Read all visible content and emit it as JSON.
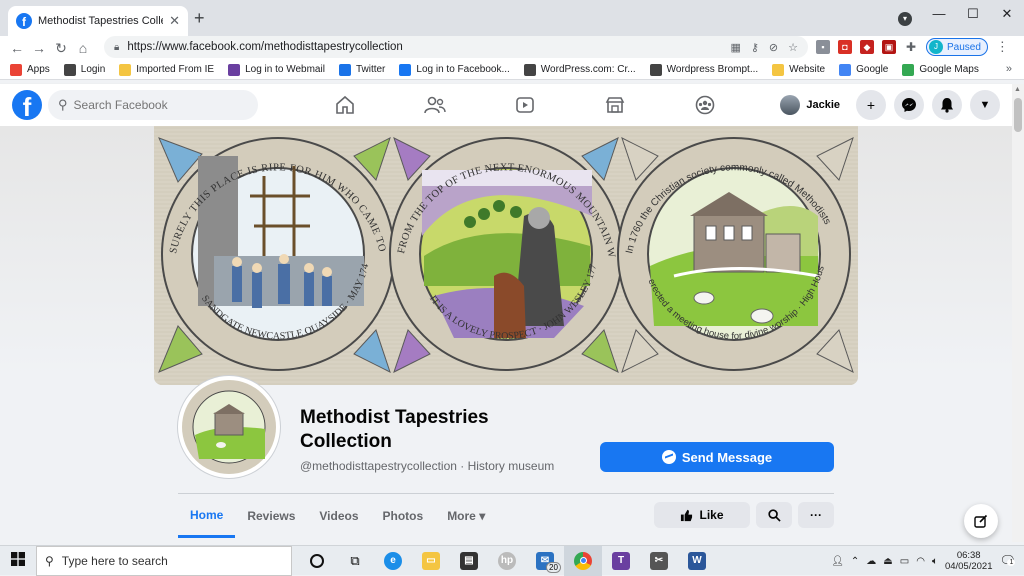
{
  "browser": {
    "tab_title": "Methodist Tapestries Collection |",
    "url": "https://www.facebook.com/methodisttapestrycollection",
    "profile_status": "Paused",
    "profile_initial": "J",
    "bookmarks": [
      {
        "label": "Apps",
        "color": "#ea4335"
      },
      {
        "label": "Login",
        "color": "#444444"
      },
      {
        "label": "Imported From IE",
        "color": "#f4c542"
      },
      {
        "label": "Log in to Webmail",
        "color": "#6a3fa0"
      },
      {
        "label": "Twitter",
        "color": "#1a73e8"
      },
      {
        "label": "Log in to Facebook...",
        "color": "#1877f2"
      },
      {
        "label": "WordPress.com: Cr...",
        "color": "#444444"
      },
      {
        "label": "Wordpress Brompt...",
        "color": "#444444"
      },
      {
        "label": "Website",
        "color": "#f4c542"
      },
      {
        "label": "Google",
        "color": "#4285f4"
      },
      {
        "label": "Google Maps",
        "color": "#34a853"
      }
    ],
    "bookmarks_more": "»"
  },
  "facebook": {
    "search_placeholder": "Search Facebook",
    "user_name": "Jackie",
    "logo_letter": "f"
  },
  "page": {
    "name": "Methodist Tapestries Collection",
    "handle_category": "@methodisttapestrycollection · History museum",
    "send_message_label": "Send Message",
    "tabs": [
      "Home",
      "Reviews",
      "Videos",
      "Photos",
      "More ▾"
    ],
    "like_label": "Like",
    "more_actions_label": "···"
  },
  "cover": {
    "panel1_text": "SURELY THIS PLACE IS RIPE FOR HIM WHO CAME TO CALL SINNERS TO REPENTANCE",
    "panel1_bottom": "SANDGATE NEWCASTLE QUAYSIDE · MAY 1742",
    "panel2_text": "FROM THE TOP OF THE NEXT ENORMOUS MOUNTAIN WE HAD A VIEW OF WEARDALE",
    "panel2_bottom": "IT IS A LOVELY PROSPECT · JOHN WESLEY 1772",
    "panel3_text": "In 1760 the Christian society commonly called Methodists",
    "panel3_bottom": "erected a meeting house for divine worship · High House"
  },
  "taskbar": {
    "search_placeholder": "Type here to search",
    "time": "06:38",
    "date": "04/05/2021",
    "mail_badge": "20",
    "notification_count": "1"
  },
  "colors": {
    "fb_blue": "#1877f2",
    "page_bg": "#f0f2f5"
  }
}
